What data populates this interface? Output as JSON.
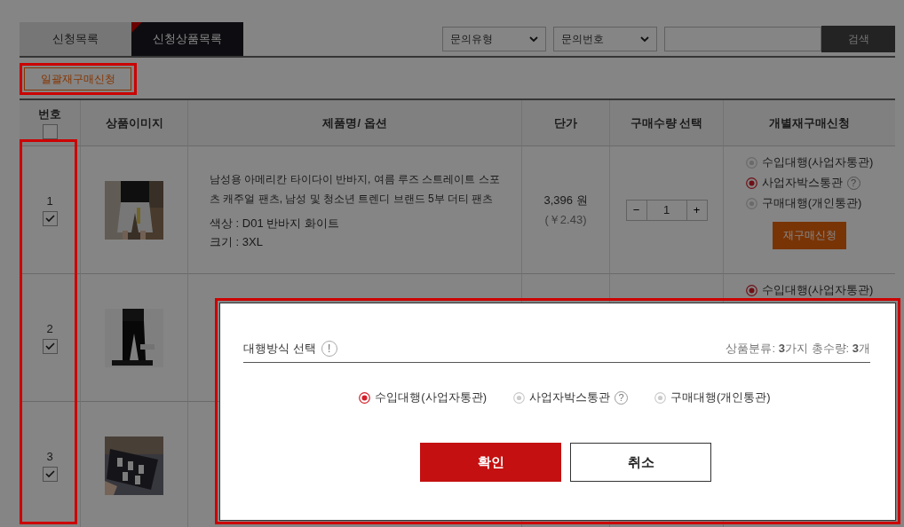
{
  "tabs": [
    {
      "label": "신청목록",
      "selected": false
    },
    {
      "label": "신청상품목록",
      "selected": true
    }
  ],
  "filters": [
    {
      "label": "문의유형"
    },
    {
      "label": "문의번호"
    }
  ],
  "search": {
    "button": "검색"
  },
  "bulk_button": "일괄재구매신청",
  "table": {
    "columns": [
      "번호",
      "상품이미지",
      "제품명/ 옵션",
      "단가",
      "구매수량 선택",
      "개별재구매신청"
    ],
    "select_all_checked": false,
    "rows": [
      {
        "no": "1",
        "checked": true,
        "image": {
          "kind": "picture"
        },
        "name": "남성용 아메리칸 타이다이 반바지, 여름 루즈 스트레이트 스포츠 캐주얼 팬츠, 남성 및 청소년 트렌디 브랜드 5부 더티 팬츠",
        "options": [
          "색상 : D01 반바지 화이트",
          "크기 : 3XL"
        ],
        "price": "3,396 원",
        "price_cny": "(￥2.43)",
        "quantity": {
          "minus": "−",
          "value": "1",
          "plus": "+"
        },
        "methods": [
          {
            "label": "수입대행(사업자통관)",
            "selected": false
          },
          {
            "label": "사업자박스통관",
            "selected": true,
            "help": "?"
          },
          {
            "label": "구매대행(개인통관)",
            "selected": false
          }
        ],
        "reorder_button": "재구매신청"
      },
      {
        "no": "2",
        "checked": true,
        "image": {
          "kind": "picture"
        },
        "methods": [
          {
            "label": "수입대행(사업자통관)",
            "selected": true
          }
        ]
      },
      {
        "no": "3",
        "checked": true,
        "image": {
          "kind": "picture"
        }
      }
    ]
  },
  "modal": {
    "title": "대행방식 선택",
    "title_icon": "!",
    "summary": "상품분류: **3**가지 총수량: **3**개",
    "methods": [
      {
        "label": "수입대행(사업자통관)",
        "selected": true
      },
      {
        "label": "사업자박스통관",
        "selected": false,
        "help": "?"
      },
      {
        "label": "구매대행(개인통관)",
        "selected": false
      }
    ],
    "confirm_button": "확인",
    "cancel_button": "취소"
  }
}
